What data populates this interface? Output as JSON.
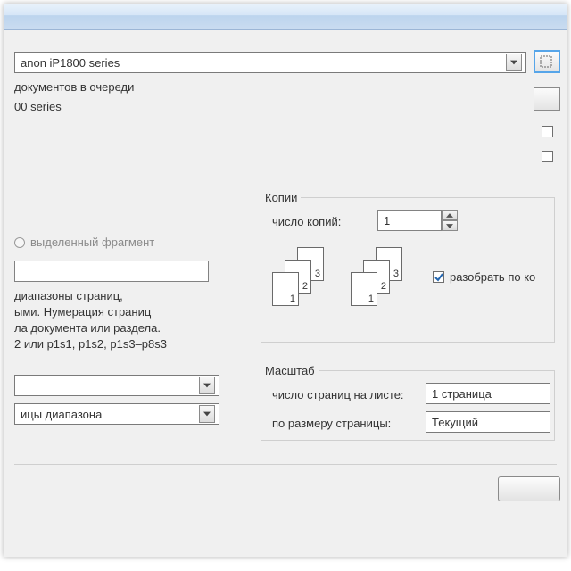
{
  "printer": {
    "selected": "anon iP1800 series",
    "status": "документов в очереди",
    "type_fragment": "00 series"
  },
  "range": {
    "radio_selection_label": "выделенный фрагмент",
    "help_line1": "диапазоны страниц,",
    "help_line2": "ыми. Нумерация страниц",
    "help_line3": "ла документа или раздела.",
    "help_line4": "2 или p1s1, p1s2, p1s3–p8s3",
    "in_range_label": "ицы диапазона"
  },
  "copies": {
    "group_title": "Копии",
    "count_label": "число копий:",
    "count_value": "1",
    "collate_label": "разобрать по ко",
    "collate_checked": true,
    "page_labels": [
      "1",
      "2",
      "3"
    ]
  },
  "zoom": {
    "group_title": "Масштаб",
    "pages_per_sheet_label": "число страниц на листе:",
    "pages_per_sheet_value": "1 страница",
    "scale_to_paper_label": "по размеру страницы:",
    "scale_to_paper_value": "Текущий"
  }
}
